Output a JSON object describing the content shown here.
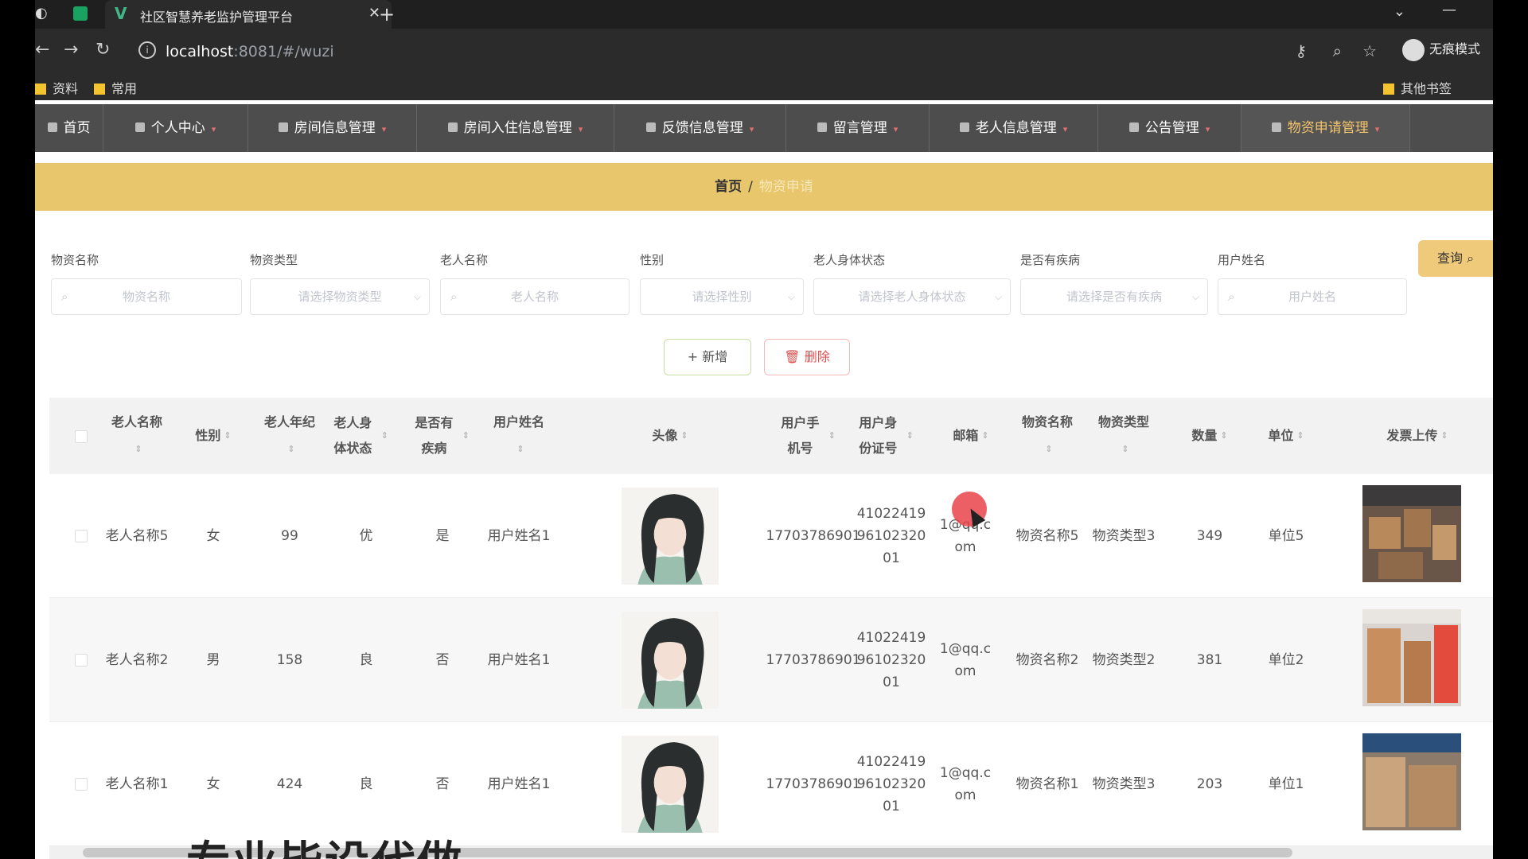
{
  "browser": {
    "tab_title": "社区智慧养老监护管理平台",
    "url_host": "localhost",
    "url_rest": ":8081/#/wuzi",
    "incognito_label": "无痕模式",
    "bookmarks": [
      "资料",
      "常用"
    ],
    "other_bookmarks": "其他书签"
  },
  "nav": {
    "items": [
      {
        "label": "首页"
      },
      {
        "label": "个人中心"
      },
      {
        "label": "房间信息管理"
      },
      {
        "label": "房间入住信息管理"
      },
      {
        "label": "反馈信息管理"
      },
      {
        "label": "留言管理"
      },
      {
        "label": "老人信息管理"
      },
      {
        "label": "公告管理"
      },
      {
        "label": "物资申请管理"
      }
    ]
  },
  "breadcrumb": {
    "home": "首页",
    "separator": "/",
    "current": "物资申请"
  },
  "search": {
    "fields": [
      {
        "label": "物资名称",
        "placeholder": "物资名称"
      },
      {
        "label": "物资类型",
        "placeholder": "请选择物资类型"
      },
      {
        "label": "老人名称",
        "placeholder": "老人名称"
      },
      {
        "label": "性别",
        "placeholder": "请选择性别"
      },
      {
        "label": "老人身体状态",
        "placeholder": "请选择老人身体状态"
      },
      {
        "label": "是否有疾病",
        "placeholder": "请选择是否有疾病"
      },
      {
        "label": "用户姓名",
        "placeholder": "用户姓名"
      }
    ],
    "query_label": "查询"
  },
  "actions": {
    "add_label": "+ 新增",
    "delete_label": "删除"
  },
  "table": {
    "headers": [
      "老人名称",
      "性别",
      "老人年纪",
      "老人身体状态",
      "是否有疾病",
      "用户姓名",
      "头像",
      "用户手机号",
      "用户身份证号",
      "邮箱",
      "物资名称",
      "物资类型",
      "数量",
      "单位",
      "发票上传"
    ],
    "rows": [
      {
        "name": "老人名称5",
        "gender": "女",
        "age": "99",
        "health": "优",
        "disease": "是",
        "user": "用户姓名1",
        "phone": "17703786901",
        "idno": "410224199610232001",
        "email": "1@qq.com",
        "item": "物资名称5",
        "type": "物资类型3",
        "qty": "349",
        "unit": "单位5"
      },
      {
        "name": "老人名称2",
        "gender": "男",
        "age": "158",
        "health": "良",
        "disease": "否",
        "user": "用户姓名1",
        "phone": "17703786901",
        "idno": "410224199610232001",
        "email": "1@qq.com",
        "item": "物资名称2",
        "type": "物资类型2",
        "qty": "381",
        "unit": "单位2"
      },
      {
        "name": "老人名称1",
        "gender": "女",
        "age": "424",
        "health": "良",
        "disease": "否",
        "user": "用户姓名1",
        "phone": "17703786901",
        "idno": "410224199610232001",
        "email": "1@qq.com",
        "item": "物资名称1",
        "type": "物资类型3",
        "qty": "203",
        "unit": "单位1"
      }
    ]
  },
  "overlay_text": "专业毕设代做",
  "colors": {
    "accent": "#e8c66b",
    "nav_bg": "#4d4d4d",
    "active_nav": "#f2c46d"
  }
}
